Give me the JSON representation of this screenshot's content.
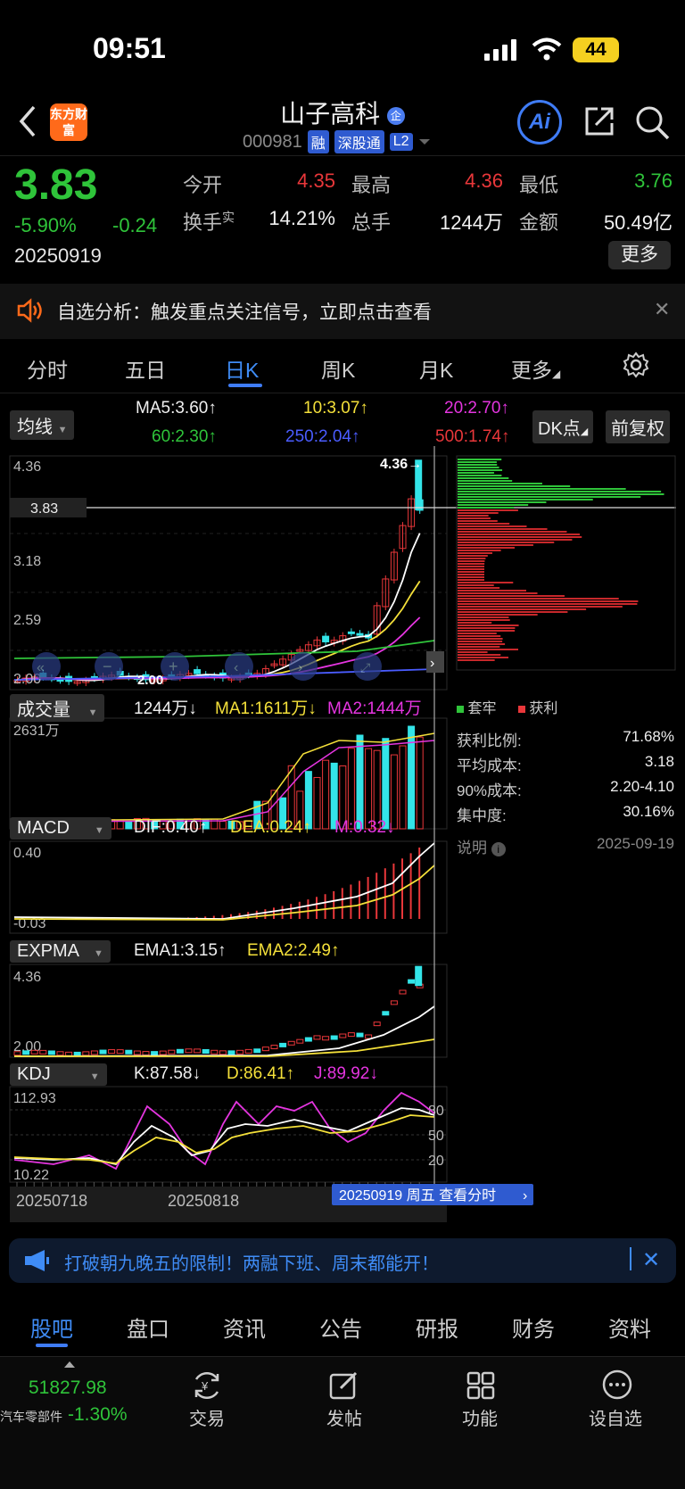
{
  "status": {
    "time": "09:51",
    "battery": "44"
  },
  "header": {
    "logo_text": "东方财富",
    "stock_name": "山子高科",
    "name_badge": "企",
    "stock_code": "000981",
    "tags": [
      "融",
      "深股通",
      "L2"
    ],
    "ai_label": "Ai"
  },
  "quote": {
    "price": "3.83",
    "change_pct": "-5.90%",
    "change": "-0.24",
    "date": "20250919",
    "open_label": "今开",
    "open": "4.35",
    "high_label": "最高",
    "high": "4.36",
    "low_label": "最低",
    "low": "3.76",
    "turnover_label": "换手",
    "turnover_sup": "实",
    "turnover": "14.21%",
    "volume_label": "总手",
    "volume": "1244万",
    "amount_label": "金额",
    "amount": "50.49亿",
    "more_label": "更多"
  },
  "notice": {
    "text": "自选分析：触发重点关注信号，立即点击查看"
  },
  "period_tabs": [
    "分时",
    "五日",
    "日K",
    "周K",
    "月K",
    "更多"
  ],
  "active_period": "日K",
  "ma": {
    "selector": "均线",
    "ma5": "MA5:3.60",
    "ma10": "10:3.07",
    "ma20": "20:2.70",
    "ma60": "60:2.30",
    "ma250": "250:2.04",
    "ma500": "500:1.74",
    "dk_label": "DK点",
    "adjust_label": "前复权"
  },
  "kchart": {
    "axis_labels": [
      "4.36",
      "3.18",
      "2.59",
      "2.00"
    ],
    "price_marker": "3.83",
    "high_marker": "4.36→",
    "low_marker": "2.00"
  },
  "chip": {
    "legend_trap": "套牢",
    "legend_profit": "获利",
    "rows": [
      {
        "label": "获利比例:",
        "value": "71.68%"
      },
      {
        "label": "平均成本:",
        "value": "3.18"
      },
      {
        "label": "90%成本:",
        "value": "2.20-4.10"
      },
      {
        "label": "集中度:",
        "value": "30.16%"
      }
    ],
    "note_label": "说明",
    "note_date": "2025-09-19"
  },
  "volume_panel": {
    "selector": "成交量",
    "current": "1244万",
    "ma1": "MA1:1611万",
    "ma2": "MA2:1444万",
    "axis_top": "2631万"
  },
  "macd_panel": {
    "selector": "MACD",
    "dif": "DIF:0.40",
    "dea": "DEA:0.24",
    "m": "M:0.32",
    "axis_top": "0.40",
    "axis_bottom": "-0.03"
  },
  "expma_panel": {
    "selector": "EXPMA",
    "ema1": "EMA1:3.15",
    "ema2": "EMA2:2.49",
    "axis_top": "4.36",
    "axis_bottom": "2.00"
  },
  "kdj_panel": {
    "selector": "KDJ",
    "k": "K:87.58",
    "d": "D:86.41",
    "j": "J:89.92",
    "axis_top": "112.93",
    "axis_bottom": "10.22",
    "levels": [
      "80",
      "50",
      "20"
    ]
  },
  "x_axis": [
    "20250718",
    "20250818"
  ],
  "crosshair_label": "20250919 周五 查看分时",
  "promo": {
    "text": "打破朝九晚五的限制！两融下班、周末都能开！"
  },
  "bottom_tabs": [
    "股吧",
    "盘口",
    "资讯",
    "公告",
    "研报",
    "财务",
    "资料"
  ],
  "active_bottom_tab": "股吧",
  "index_ticker": {
    "value": "51827.98",
    "name": "汽车零部件",
    "change": "-1.30%"
  },
  "toolbar": [
    "交易",
    "发帖",
    "功能",
    "设自选"
  ],
  "colors": {
    "up": "#e9373a",
    "down": "#2fc43a",
    "accent": "#3f7cf6",
    "cyan": "#33e4e8"
  }
}
